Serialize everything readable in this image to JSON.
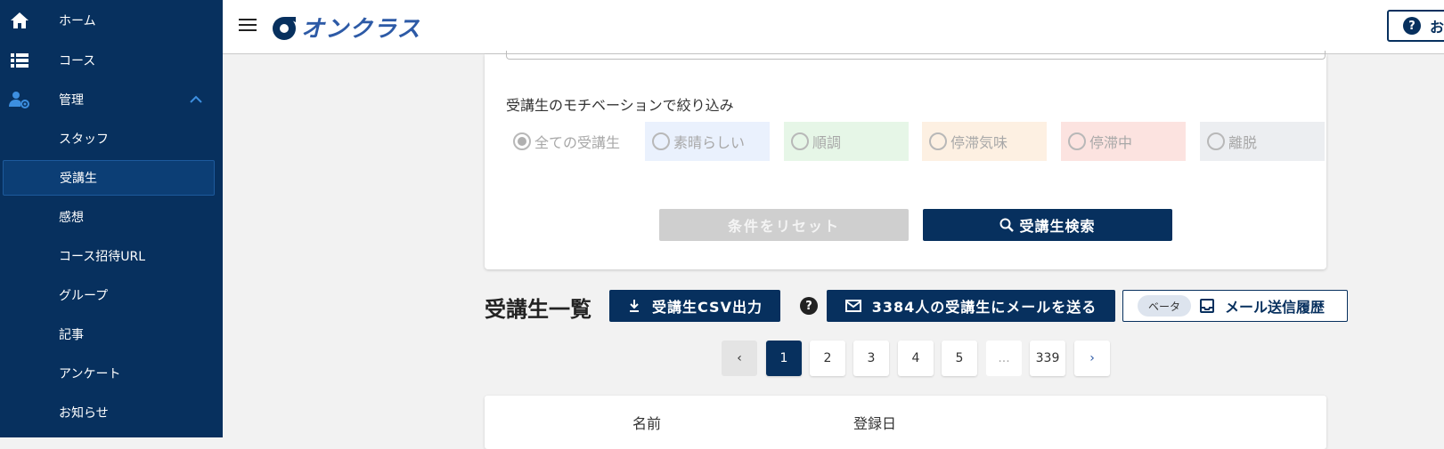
{
  "sidebar": {
    "items": [
      {
        "label": "ホーム",
        "icon": "home-icon"
      },
      {
        "label": "コース",
        "icon": "list-icon"
      },
      {
        "label": "管理",
        "icon": "user-gear-icon"
      },
      {
        "label": "スタッフ"
      },
      {
        "label": "受講生"
      },
      {
        "label": "感想"
      },
      {
        "label": "コース招待URL"
      },
      {
        "label": "グループ"
      },
      {
        "label": "記事"
      },
      {
        "label": "アンケート"
      },
      {
        "label": "お知らせ"
      }
    ]
  },
  "header": {
    "logo_text": "オンクラス",
    "help_label": "お"
  },
  "filter": {
    "title": "受講生のモチベーションで絞り込み",
    "options": [
      {
        "label": "全ての受講生",
        "selected": true,
        "bg": "#ffffff"
      },
      {
        "label": "素晴らしい",
        "selected": false,
        "bg": "#eaf1fd"
      },
      {
        "label": "順調",
        "selected": false,
        "bg": "#e6f6e7"
      },
      {
        "label": "停滞気味",
        "selected": false,
        "bg": "#fdf0e2"
      },
      {
        "label": "停滞中",
        "selected": false,
        "bg": "#fce3e0"
      },
      {
        "label": "離脱",
        "selected": false,
        "bg": "#eceef1"
      }
    ],
    "reset_label": "条件をリセット",
    "search_label": "受講生検索"
  },
  "list": {
    "title": "受講生一覧",
    "csv_label": "受講生CSV出力",
    "mail_label": "3384人の受講生にメールを送る",
    "beta_label": "ベータ",
    "history_label": "メール送信履歴"
  },
  "pagination": {
    "prev": "‹",
    "pages": [
      "1",
      "2",
      "3",
      "4",
      "5",
      "...",
      "339"
    ],
    "next": "›",
    "current": "1"
  },
  "table": {
    "columns": [
      "名前",
      "登録日"
    ]
  },
  "colors": {
    "navy": "#07305e",
    "brand_blue": "#2d5aa6"
  }
}
